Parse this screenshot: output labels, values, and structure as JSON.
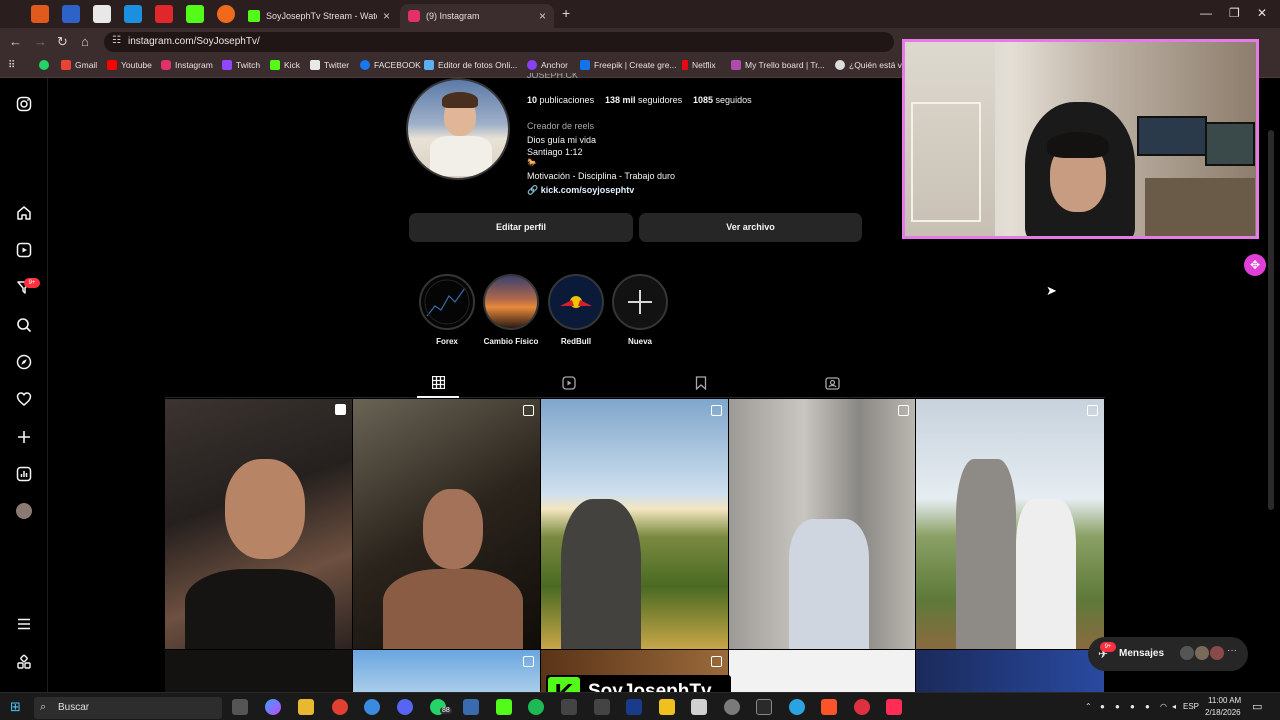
{
  "browser": {
    "tabs": [
      {
        "title": "SoyJosephTv Stream - Watch Li",
        "favicon_color": "#53fc18"
      },
      {
        "title": "(9) Instagram",
        "favicon_color": "#e1306c"
      }
    ],
    "new_tab": "+",
    "url": "instagram.com/SoyJosephTv/",
    "bookmarks": [
      "Gmail",
      "Youtube",
      "Instagram",
      "Twitch",
      "Kick",
      "Twitter",
      "FACEBOOK",
      "Editor de fotos Onli...",
      "Anchor",
      "Freepik | Create gre...",
      "Netflix",
      "My Trello board | Tr...",
      "¿Quién está vie"
    ]
  },
  "profile": {
    "username_partial": "JOSEPH.CK",
    "posts_count": "10",
    "posts_label": "publicaciones",
    "followers_count": "138 mil",
    "followers_label": "seguidores",
    "following_count": "1085",
    "following_label": "seguidos",
    "category": "Creador de reels",
    "bio_line1": "Dios guía mi vida",
    "bio_line2": "Santiago 1:12",
    "bio_line3": "🐎",
    "bio_line4": "Motivación - Disciplina - Trabajo duro",
    "link": "kick.com/soyjosephtv",
    "edit_button": "Editar perfil",
    "archive_button": "Ver archivo"
  },
  "highlights": [
    {
      "label": "Forex"
    },
    {
      "label": "Cambio Físico"
    },
    {
      "label": "RedBull"
    },
    {
      "label": "Nueva"
    }
  ],
  "notifications_badge": "9+",
  "messages": {
    "label": "Mensajes",
    "badge": "9+"
  },
  "stream_overlay": {
    "name": "SoyJosephTv"
  },
  "taskbar": {
    "search_placeholder": "Buscar",
    "whatsapp_badge": "88",
    "language": "ESP",
    "time": "11:00 AM",
    "date": "2/18/2026"
  },
  "colors": {
    "accent": "#0095f6",
    "kick_green": "#53fc18",
    "webcam_border": "#e57ce6"
  }
}
